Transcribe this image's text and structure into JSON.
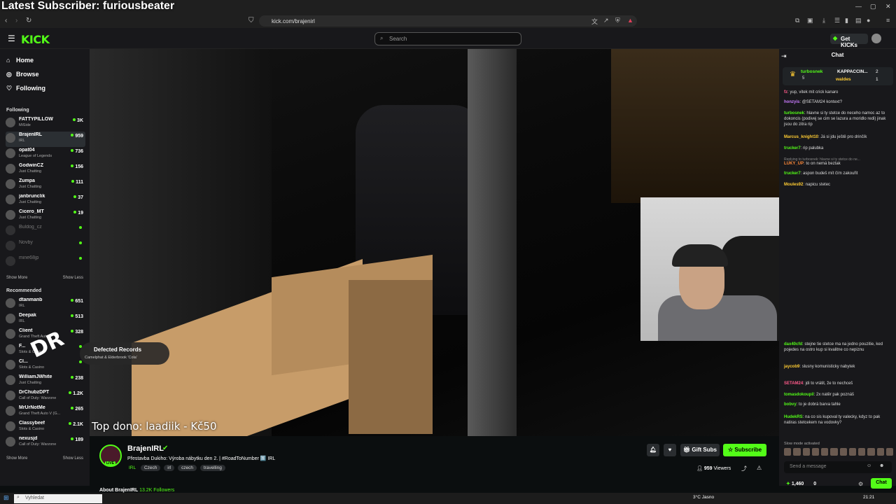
{
  "overlay_text": "Latest Subscriber: furiousbeater",
  "browser": {
    "url": "kick.com/brajenirl"
  },
  "header": {
    "logo": "KICK",
    "search_placeholder": "Search",
    "get_kicks": "Get KICKs"
  },
  "sidebar": {
    "nav": [
      {
        "label": "Home",
        "icon": "home-icon"
      },
      {
        "label": "Browse",
        "icon": "compass-icon"
      },
      {
        "label": "Following",
        "icon": "heart-icon"
      }
    ],
    "following_title": "Following",
    "following": [
      {
        "name": "FATTYPILLOW",
        "category": "MiSide",
        "viewers": "3K"
      },
      {
        "name": "BrajenIRL",
        "category": "IRL",
        "viewers": "959"
      },
      {
        "name": "opat04",
        "category": "League of Legends",
        "viewers": "736"
      },
      {
        "name": "GodwinCZ",
        "category": "Just Chatting",
        "viewers": "156"
      },
      {
        "name": "Zumpa",
        "category": "Just Chatting",
        "viewers": "111"
      },
      {
        "name": "janbrunclik",
        "category": "Just Chatting",
        "viewers": "37"
      },
      {
        "name": "Cicero_MT",
        "category": "Just Chatting",
        "viewers": "19"
      },
      {
        "name": "Buldog_cz",
        "category": "",
        "viewers": ""
      },
      {
        "name": "Novby",
        "category": "",
        "viewers": ""
      },
      {
        "name": "mine68jp",
        "category": "",
        "viewers": ""
      }
    ],
    "show_more": "Show More",
    "show_less": "Show Less",
    "recommended_title": "Recommended",
    "recommended": [
      {
        "name": "dtanmanb",
        "category": "IRL",
        "viewers": "651"
      },
      {
        "name": "Deepak",
        "category": "IRL",
        "viewers": "513"
      },
      {
        "name": "Client",
        "category": "Grand Theft Auto V",
        "viewers": "328"
      },
      {
        "name": "F...",
        "category": "Slots & Casino",
        "viewers": ""
      },
      {
        "name": "Cl...",
        "category": "Slots & Casino",
        "viewers": ""
      },
      {
        "name": "WilliamJWhite",
        "category": "Just Chatting",
        "viewers": "238"
      },
      {
        "name": "DrChubzDPT",
        "category": "Call of Duty: Warzone",
        "viewers": "1.2K"
      },
      {
        "name": "MrUrNotMe",
        "category": "Grand Theft Auto V (G...",
        "viewers": "265"
      },
      {
        "name": "Classybeef",
        "category": "Slots & Casino",
        "viewers": "2.1K"
      },
      {
        "name": "nexusjd",
        "category": "Call of Duty: Warzone",
        "viewers": "189"
      }
    ]
  },
  "video": {
    "top_dono": "Top dono: laadiik - Kč50"
  },
  "now_playing": {
    "title": "Defected Records",
    "subtitle": "Camelphat & Elderbrook 'Cola'"
  },
  "channel": {
    "name": "BrajenIRL",
    "live_badge": "LIVE",
    "title": "Přestavba Dukiho: Výroba nábytku den 2. | #RoadToNumber 1️⃣ IRL",
    "tags": [
      "IRL",
      "Czech",
      "irl",
      "czech",
      "travelling"
    ],
    "gift_subs": "Gift Subs",
    "subscribe": "Subscribe",
    "viewers": "959",
    "viewers_label": "Viewers",
    "about": "About BrajenIRL",
    "followers": "13.2K Followers"
  },
  "chat": {
    "title": "Chat",
    "pinned": {
      "user": "turbosnek",
      "text": "KAPPACCIN...",
      "count1": "2",
      "user2": "waldes",
      "count2": "1",
      "sub": "5"
    },
    "messages": [
      {
        "user": "fz",
        "color": "#ff5a8a",
        "text": "yup, vitek mit crick kanaro"
      },
      {
        "user": "honzyis",
        "color": "#c97bff",
        "text": "@SETAM24 kontext?"
      },
      {
        "user": "turbosnek",
        "color": "#53fc18",
        "text": "hlavne si ty stetce do neceho namoc az to dokoncis (podivej se cim se lazura a moridlo redi) jinak jsou do zitra rip"
      },
      {
        "user": "Marcus_knight10",
        "color": "#ffcc33",
        "text": "Já si jdu ještě pro drinčík"
      },
      {
        "user": "trucker7",
        "color": "#53fc18",
        "text": "rip palubka"
      },
      {
        "user": "LUKY_UP",
        "color": "#ff8a3a",
        "text": "to on nemá beztak"
      },
      {
        "user": "trucker7",
        "color": "#53fc18",
        "text": "aspon budeš mít čím zakouřit"
      },
      {
        "user": "Moules92",
        "color": "#ffcc33",
        "text": "napicu stetec"
      },
      {
        "user": "dax40cfd",
        "color": "#53fc18",
        "text": "stejne tie stetce ma na jedno pouzitie, ked pojedes na ostro kup si kvalitne co nepiznu"
      },
      {
        "user": "jaycob9",
        "color": "#ffcc33",
        "text": "slusny komunisticky nabytek"
      },
      {
        "user": "SETAM24",
        "color": "#ff5a8a",
        "text": "jdi to vrátit, že to nechceš"
      },
      {
        "user": "tomasdokoupil",
        "color": "#53fc18",
        "text": "2x natěr pak poznáš"
      },
      {
        "user": "bobvy",
        "color": "#53fc18",
        "text": "to je dobrá barva tahle"
      },
      {
        "user": "HudekRS",
        "color": "#53fc18",
        "text": "na co sis kupoval ty valecky, kdyz to pak natiras stetcekem na vodovky?"
      }
    ],
    "reply_note": "Replying to turbosnek: hlavne si ty stetce do ne...",
    "slow_mode": "Slow mode activated",
    "send_placeholder": "Send a message",
    "points": "1,460",
    "zero": "0",
    "chat_button": "Chat"
  },
  "taskbar": {
    "search": "Vyhledat",
    "weather": "3°C Jasno",
    "time": "21:21"
  }
}
